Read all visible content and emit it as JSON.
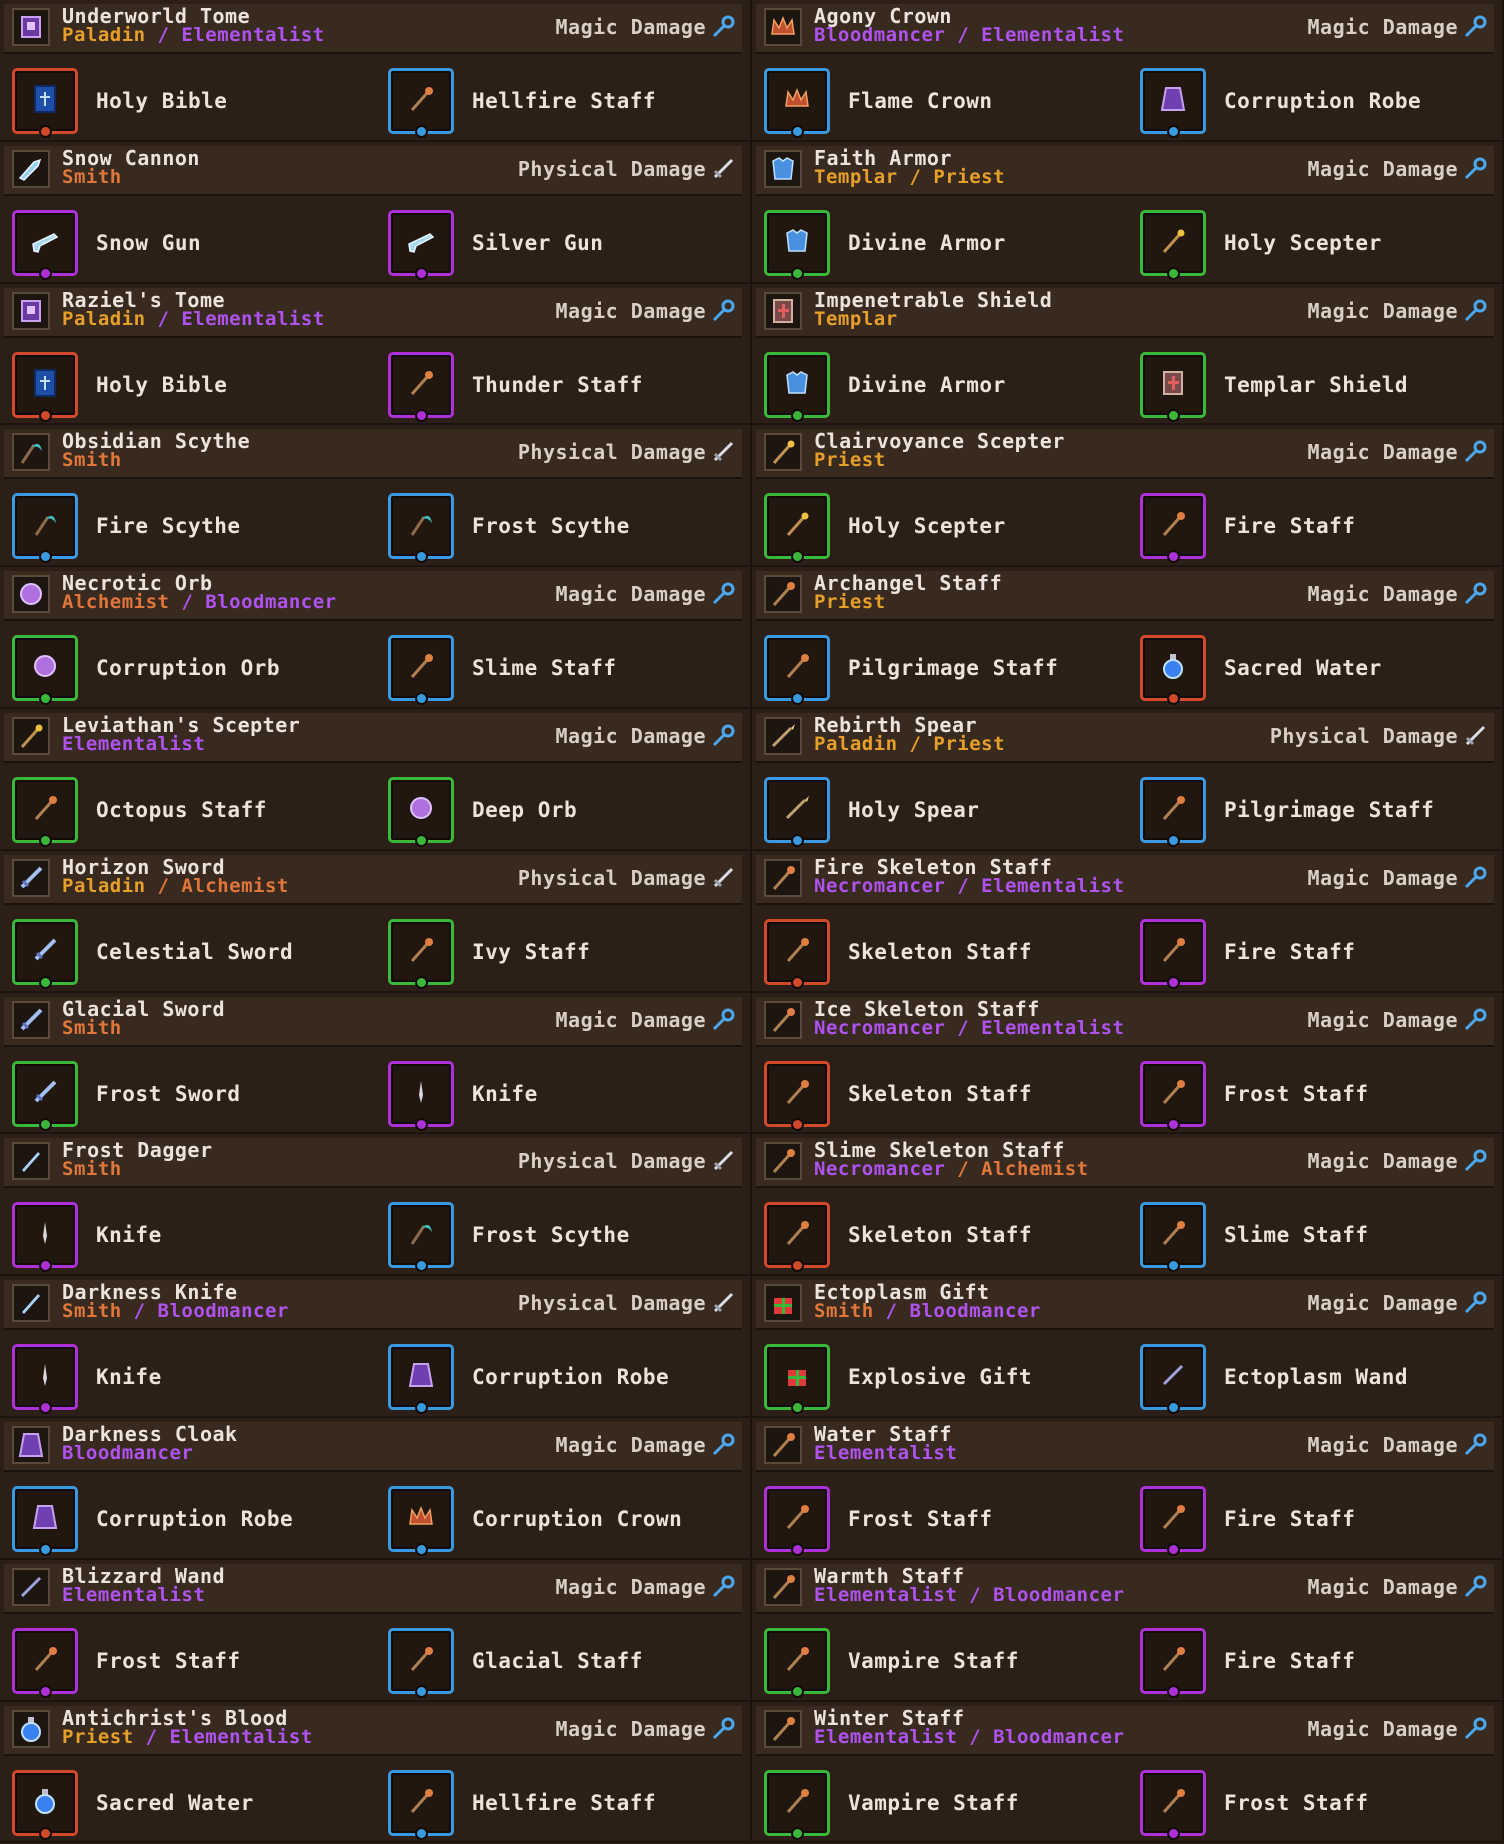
{
  "colors": {
    "class_paladin": "#e6a02a",
    "class_elementalist": "#b052f0",
    "class_smith": "#e0763a",
    "class_bloodmancer": "#b052f0",
    "class_templar": "#e6a02a",
    "class_priest": "#e6a02a",
    "class_alchemist": "#e0763a",
    "class_necromancer": "#b052f0",
    "rarity_red": "#d24a2a",
    "rarity_blue": "#3a9ae0",
    "rarity_purple": "#b030d8",
    "rarity_green": "#3ab83a"
  },
  "recipes": [
    {
      "name": "Underworld Tome",
      "classes": [
        {
          "text": "Paladin",
          "color": "#e6a02a"
        },
        {
          "text": "Elementalist",
          "color": "#b052f0"
        }
      ],
      "damage": "Magic Damage",
      "damage_icon": "magic-icon",
      "icon": "tome-icon",
      "items": [
        {
          "name": "Holy Bible",
          "rarity": "red",
          "icon": "bible-icon"
        },
        {
          "name": "Hellfire Staff",
          "rarity": "blue",
          "icon": "staff-icon"
        }
      ]
    },
    {
      "name": "Snow Cannon",
      "classes": [
        {
          "text": "Smith",
          "color": "#e0763a"
        }
      ],
      "damage": "Physical Damage",
      "damage_icon": "sword-icon",
      "icon": "cannon-icon",
      "items": [
        {
          "name": "Snow Gun",
          "rarity": "purple",
          "icon": "gun-icon"
        },
        {
          "name": "Silver Gun",
          "rarity": "purple",
          "icon": "gun-icon"
        }
      ]
    },
    {
      "name": "Raziel's Tome",
      "classes": [
        {
          "text": "Paladin",
          "color": "#e6a02a"
        },
        {
          "text": "Elementalist",
          "color": "#b052f0"
        }
      ],
      "damage": "Magic Damage",
      "damage_icon": "magic-icon",
      "icon": "tome-icon",
      "items": [
        {
          "name": "Holy Bible",
          "rarity": "red",
          "icon": "bible-icon"
        },
        {
          "name": "Thunder Staff",
          "rarity": "purple",
          "icon": "staff-icon"
        }
      ]
    },
    {
      "name": "Obsidian Scythe",
      "classes": [
        {
          "text": "Smith",
          "color": "#e0763a"
        }
      ],
      "damage": "Physical Damage",
      "damage_icon": "sword-icon",
      "icon": "scythe-icon",
      "items": [
        {
          "name": "Fire Scythe",
          "rarity": "blue",
          "icon": "scythe-icon"
        },
        {
          "name": "Frost Scythe",
          "rarity": "blue",
          "icon": "scythe-icon"
        }
      ]
    },
    {
      "name": "Necrotic Orb",
      "classes": [
        {
          "text": "Alchemist",
          "color": "#e0763a"
        },
        {
          "text": "Bloodmancer",
          "color": "#b052f0"
        }
      ],
      "damage": "Magic Damage",
      "damage_icon": "magic-icon",
      "icon": "orb-icon",
      "items": [
        {
          "name": "Corruption Orb",
          "rarity": "green",
          "icon": "orb-icon"
        },
        {
          "name": "Slime Staff",
          "rarity": "blue",
          "icon": "staff-icon"
        }
      ]
    },
    {
      "name": "Leviathan's Scepter",
      "classes": [
        {
          "text": "Elementalist",
          "color": "#b052f0"
        }
      ],
      "damage": "Magic Damage",
      "damage_icon": "magic-icon",
      "icon": "scepter-icon",
      "items": [
        {
          "name": "Octopus Staff",
          "rarity": "green",
          "icon": "staff-icon"
        },
        {
          "name": "Deep Orb",
          "rarity": "green",
          "icon": "orb-icon"
        }
      ]
    },
    {
      "name": "Horizon Sword",
      "classes": [
        {
          "text": "Paladin",
          "color": "#e6a02a"
        },
        {
          "text": "Alchemist",
          "color": "#e0763a"
        }
      ],
      "damage": "Physical Damage",
      "damage_icon": "sword-icon",
      "icon": "sword-icon",
      "items": [
        {
          "name": "Celestial Sword",
          "rarity": "green",
          "icon": "sword-icon"
        },
        {
          "name": "Ivy Staff",
          "rarity": "green",
          "icon": "staff-icon"
        }
      ]
    },
    {
      "name": "Glacial Sword",
      "classes": [
        {
          "text": "Smith",
          "color": "#e0763a"
        }
      ],
      "damage": "Magic Damage",
      "damage_icon": "magic-icon",
      "icon": "sword-icon",
      "items": [
        {
          "name": "Frost Sword",
          "rarity": "green",
          "icon": "sword-icon"
        },
        {
          "name": "Knife",
          "rarity": "purple",
          "icon": "knife-icon"
        }
      ]
    },
    {
      "name": "Frost Dagger",
      "classes": [
        {
          "text": "Smith",
          "color": "#e0763a"
        }
      ],
      "damage": "Physical Damage",
      "damage_icon": "sword-icon",
      "icon": "dagger-icon",
      "items": [
        {
          "name": "Knife",
          "rarity": "purple",
          "icon": "knife-icon"
        },
        {
          "name": "Frost Scythe",
          "rarity": "blue",
          "icon": "scythe-icon"
        }
      ]
    },
    {
      "name": "Darkness Knife",
      "classes": [
        {
          "text": "Smith",
          "color": "#e0763a"
        },
        {
          "text": "Bloodmancer",
          "color": "#b052f0"
        }
      ],
      "damage": "Physical Damage",
      "damage_icon": "sword-icon",
      "icon": "dagger-icon",
      "items": [
        {
          "name": "Knife",
          "rarity": "purple",
          "icon": "knife-icon"
        },
        {
          "name": "Corruption Robe",
          "rarity": "blue",
          "icon": "robe-icon"
        }
      ]
    },
    {
      "name": "Darkness Cloak",
      "classes": [
        {
          "text": "Bloodmancer",
          "color": "#b052f0"
        }
      ],
      "damage": "Magic Damage",
      "damage_icon": "magic-icon",
      "icon": "robe-icon",
      "items": [
        {
          "name": "Corruption Robe",
          "rarity": "blue",
          "icon": "robe-icon"
        },
        {
          "name": "Corruption Crown",
          "rarity": "blue",
          "icon": "crown-icon"
        }
      ]
    },
    {
      "name": "Blizzard Wand",
      "classes": [
        {
          "text": "Elementalist",
          "color": "#b052f0"
        }
      ],
      "damage": "Magic Damage",
      "damage_icon": "magic-icon",
      "icon": "wand-icon",
      "items": [
        {
          "name": "Frost Staff",
          "rarity": "purple",
          "icon": "staff-icon"
        },
        {
          "name": "Glacial Staff",
          "rarity": "blue",
          "icon": "staff-icon"
        }
      ]
    },
    {
      "name": "Antichrist's Blood",
      "classes": [
        {
          "text": "Priest",
          "color": "#e6a02a"
        },
        {
          "text": "Elementalist",
          "color": "#b052f0"
        }
      ],
      "damage": "Magic Damage",
      "damage_icon": "magic-icon",
      "icon": "potion-icon",
      "items": [
        {
          "name": "Sacred Water",
          "rarity": "red",
          "icon": "potion-icon"
        },
        {
          "name": "Hellfire Staff",
          "rarity": "blue",
          "icon": "staff-icon"
        }
      ]
    },
    {
      "name": "Agony Crown",
      "classes": [
        {
          "text": "Bloodmancer",
          "color": "#b052f0"
        },
        {
          "text": "Elementalist",
          "color": "#b052f0"
        }
      ],
      "damage": "Magic Damage",
      "damage_icon": "magic-icon",
      "icon": "crown-icon",
      "items": [
        {
          "name": "Flame Crown",
          "rarity": "blue",
          "icon": "crown-icon"
        },
        {
          "name": "Corruption Robe",
          "rarity": "blue",
          "icon": "robe-icon"
        }
      ]
    },
    {
      "name": "Faith Armor",
      "classes": [
        {
          "text": "Templar",
          "color": "#e6a02a"
        },
        {
          "text": "Priest",
          "color": "#e6a02a"
        }
      ],
      "damage": "Magic Damage",
      "damage_icon": "magic-icon",
      "icon": "armor-icon",
      "items": [
        {
          "name": "Divine Armor",
          "rarity": "green",
          "icon": "armor-icon"
        },
        {
          "name": "Holy Scepter",
          "rarity": "green",
          "icon": "scepter-icon"
        }
      ]
    },
    {
      "name": "Impenetrable Shield",
      "classes": [
        {
          "text": "Templar",
          "color": "#e6a02a"
        }
      ],
      "damage": "Magic Damage",
      "damage_icon": "magic-icon",
      "icon": "shield-icon",
      "items": [
        {
          "name": "Divine Armor",
          "rarity": "green",
          "icon": "armor-icon"
        },
        {
          "name": "Templar Shield",
          "rarity": "green",
          "icon": "shield-icon"
        }
      ]
    },
    {
      "name": "Clairvoyance Scepter",
      "classes": [
        {
          "text": "Priest",
          "color": "#e6a02a"
        }
      ],
      "damage": "Magic Damage",
      "damage_icon": "magic-icon",
      "icon": "scepter-icon",
      "items": [
        {
          "name": "Holy Scepter",
          "rarity": "green",
          "icon": "scepter-icon"
        },
        {
          "name": "Fire Staff",
          "rarity": "purple",
          "icon": "staff-icon"
        }
      ]
    },
    {
      "name": "Archangel Staff",
      "classes": [
        {
          "text": "Priest",
          "color": "#e6a02a"
        }
      ],
      "damage": "Magic Damage",
      "damage_icon": "magic-icon",
      "icon": "staff-icon",
      "items": [
        {
          "name": "Pilgrimage Staff",
          "rarity": "blue",
          "icon": "staff-icon"
        },
        {
          "name": "Sacred Water",
          "rarity": "red",
          "icon": "potion-icon"
        }
      ]
    },
    {
      "name": "Rebirth Spear",
      "classes": [
        {
          "text": "Paladin",
          "color": "#e6a02a"
        },
        {
          "text": "Priest",
          "color": "#e6a02a"
        }
      ],
      "damage": "Physical Damage",
      "damage_icon": "sword-icon",
      "icon": "spear-icon",
      "items": [
        {
          "name": "Holy Spear",
          "rarity": "blue",
          "icon": "spear-icon"
        },
        {
          "name": "Pilgrimage Staff",
          "rarity": "blue",
          "icon": "staff-icon"
        }
      ]
    },
    {
      "name": "Fire Skeleton Staff",
      "classes": [
        {
          "text": "Necromancer",
          "color": "#b052f0"
        },
        {
          "text": "Elementalist",
          "color": "#b052f0"
        }
      ],
      "damage": "Magic Damage",
      "damage_icon": "magic-icon",
      "icon": "staff-icon",
      "items": [
        {
          "name": "Skeleton Staff",
          "rarity": "red",
          "icon": "staff-icon"
        },
        {
          "name": "Fire Staff",
          "rarity": "purple",
          "icon": "staff-icon"
        }
      ]
    },
    {
      "name": "Ice Skeleton Staff",
      "classes": [
        {
          "text": "Necromancer",
          "color": "#b052f0"
        },
        {
          "text": "Elementalist",
          "color": "#b052f0"
        }
      ],
      "damage": "Magic Damage",
      "damage_icon": "magic-icon",
      "icon": "staff-icon",
      "items": [
        {
          "name": "Skeleton Staff",
          "rarity": "red",
          "icon": "staff-icon"
        },
        {
          "name": "Frost Staff",
          "rarity": "purple",
          "icon": "staff-icon"
        }
      ]
    },
    {
      "name": "Slime Skeleton Staff",
      "classes": [
        {
          "text": "Necromancer",
          "color": "#b052f0"
        },
        {
          "text": "Alchemist",
          "color": "#e0763a"
        }
      ],
      "damage": "Magic Damage",
      "damage_icon": "magic-icon",
      "icon": "staff-icon",
      "items": [
        {
          "name": "Skeleton Staff",
          "rarity": "red",
          "icon": "staff-icon"
        },
        {
          "name": "Slime Staff",
          "rarity": "blue",
          "icon": "staff-icon"
        }
      ]
    },
    {
      "name": "Ectoplasm Gift",
      "classes": [
        {
          "text": "Smith",
          "color": "#e0763a"
        },
        {
          "text": "Bloodmancer",
          "color": "#b052f0"
        }
      ],
      "damage": "Magic Damage",
      "damage_icon": "magic-icon",
      "icon": "gift-icon",
      "items": [
        {
          "name": "Explosive Gift",
          "rarity": "green",
          "icon": "gift-icon"
        },
        {
          "name": "Ectoplasm Wand",
          "rarity": "blue",
          "icon": "wand-icon"
        }
      ]
    },
    {
      "name": "Water Staff",
      "classes": [
        {
          "text": "Elementalist",
          "color": "#b052f0"
        }
      ],
      "damage": "Magic Damage",
      "damage_icon": "magic-icon",
      "icon": "staff-icon",
      "items": [
        {
          "name": "Frost Staff",
          "rarity": "purple",
          "icon": "staff-icon"
        },
        {
          "name": "Fire Staff",
          "rarity": "purple",
          "icon": "staff-icon"
        }
      ]
    },
    {
      "name": "Warmth Staff",
      "classes": [
        {
          "text": "Elementalist",
          "color": "#b052f0"
        },
        {
          "text": "Bloodmancer",
          "color": "#b052f0"
        }
      ],
      "damage": "Magic Damage",
      "damage_icon": "magic-icon",
      "icon": "staff-icon",
      "items": [
        {
          "name": "Vampire Staff",
          "rarity": "green",
          "icon": "staff-icon"
        },
        {
          "name": "Fire Staff",
          "rarity": "purple",
          "icon": "staff-icon"
        }
      ]
    },
    {
      "name": "Winter Staff",
      "classes": [
        {
          "text": "Elementalist",
          "color": "#b052f0"
        },
        {
          "text": "Bloodmancer",
          "color": "#b052f0"
        }
      ],
      "damage": "Magic Damage",
      "damage_icon": "magic-icon",
      "icon": "staff-icon",
      "items": [
        {
          "name": "Vampire Staff",
          "rarity": "green",
          "icon": "staff-icon"
        },
        {
          "name": "Frost Staff",
          "rarity": "purple",
          "icon": "staff-icon"
        }
      ]
    }
  ],
  "class_separator": " / "
}
